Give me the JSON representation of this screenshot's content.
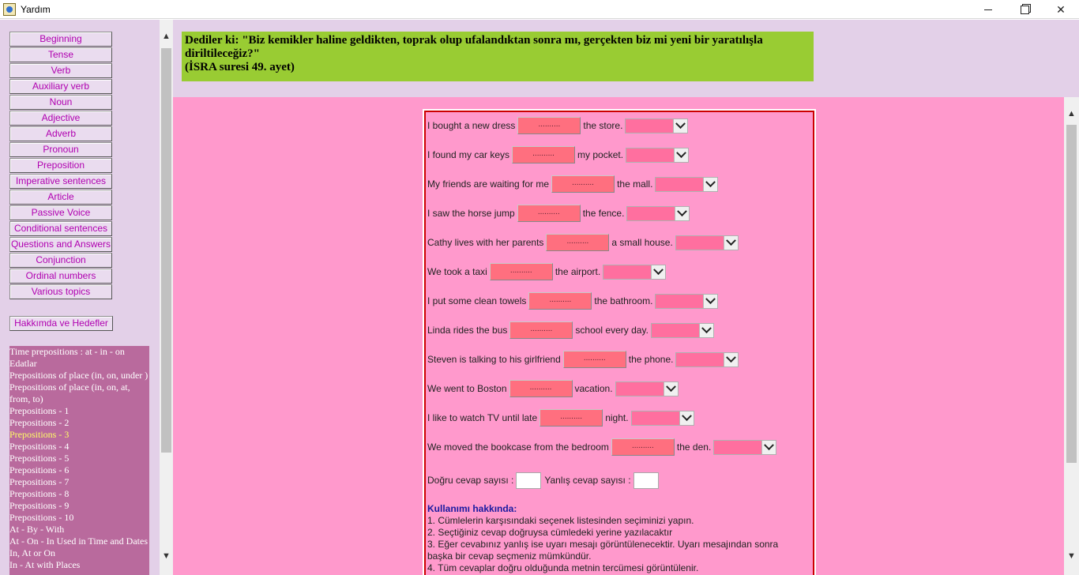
{
  "window": {
    "title": "Yardım"
  },
  "nav": {
    "items": [
      "Beginning",
      "Tense",
      "Verb",
      "Auxiliary verb",
      "Noun",
      "Adjective",
      "Adverb",
      "Pronoun",
      "Preposition",
      "Imperative sentences",
      "Article",
      "Passive Voice",
      "Conditional sentences",
      "Questions and Answers",
      "Conjunction",
      "Ordinal numbers",
      "Various topics"
    ],
    "about": "Hakkımda ve Hedefler"
  },
  "topics": [
    "Time prepositions : at - in - on",
    "Edatlar",
    "Prepositions of place (in, on, under )",
    "Prepositions of place (in, on, at, from, to)",
    "Prepositions - 1",
    "Prepositions - 2",
    "Prepositions - 3",
    "Prepositions - 4",
    "Prepositions - 5",
    "Prepositions - 6",
    "Prepositions - 7",
    "Prepositions - 8",
    "Prepositions - 9",
    "Prepositions - 10",
    "At - By - With",
    "At - On - In Used in Time and Dates",
    "In, At or On",
    "In - At with Places"
  ],
  "active_topic": "Prepositions - 3",
  "verse": {
    "line1": "Dediler ki: \"Biz kemikler haline geldikten, toprak olup ufalandıktan sonra mı, gerçekten biz mi yeni bir yaratılışla diriltileceğiz?\"",
    "line2": "(İSRA suresi 49. ayet)"
  },
  "exercise": {
    "blank_text": "..........",
    "sentences": [
      {
        "before": "I bought a new dress",
        "after": "the store."
      },
      {
        "before": "I found my car keys",
        "after": "my pocket."
      },
      {
        "before": "My friends are waiting for me",
        "after": "the mall."
      },
      {
        "before": "I saw the horse jump",
        "after": "the fence."
      },
      {
        "before": "Cathy lives with her parents",
        "after": "a small house."
      },
      {
        "before": "We took a taxi",
        "after": "the airport."
      },
      {
        "before": "I put some clean towels",
        "after": "the bathroom."
      },
      {
        "before": "Linda rides the bus",
        "after": "school every day."
      },
      {
        "before": "Steven is talking to his girlfriend",
        "after": "the phone."
      },
      {
        "before": "We went to Boston",
        "after": "vacation."
      },
      {
        "before": "I like to watch TV until late",
        "after": "night."
      },
      {
        "before": "We moved the bookcase from the bedroom",
        "after": "the den."
      }
    ],
    "correct_label": "Doğru cevap sayısı :",
    "wrong_label": "Yanlış cevap sayısı :",
    "help_title": "Kullanımı hakkında:",
    "help_lines": [
      "1. Cümlelerin karşısındaki seçenek listesinden seçiminizi yapın.",
      "2. Seçtiğiniz cevap doğruysa cümledeki yerine yazılacaktır",
      "3. Eğer cevabınız yanlış ise uyarı mesajı görüntülenecektir. Uyarı mesajından sonra başka bir cevap seçmeniz mümkündür.",
      "4. Tüm cevaplar doğru olduğunda metnin tercümesi görüntülenir."
    ]
  }
}
